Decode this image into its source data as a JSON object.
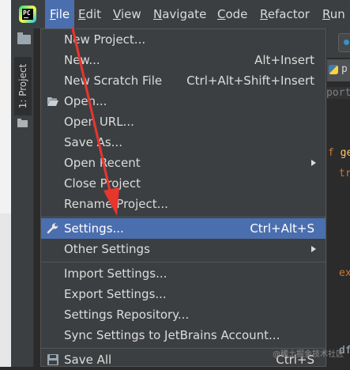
{
  "menubar": {
    "items": [
      {
        "label": "File",
        "mnemonic": "F",
        "rest": "ile",
        "active": true
      },
      {
        "label": "Edit",
        "mnemonic": "E",
        "rest": "dit"
      },
      {
        "label": "View",
        "mnemonic": "V",
        "rest": "iew"
      },
      {
        "label": "Navigate",
        "mnemonic": "N",
        "rest": "avigate"
      },
      {
        "label": "Code",
        "mnemonic": "C",
        "rest": "ode"
      },
      {
        "label": "Refactor",
        "mnemonic": "R",
        "rest": "efactor"
      },
      {
        "label": "Run",
        "mnemonic": "R",
        "rest": "un"
      }
    ]
  },
  "sidebar": {
    "project_tab": "1: Project"
  },
  "editor_fragments": {
    "tab_text": "p",
    "line1": "port",
    "line2_kw": "f",
    "line2_rest": " ge",
    "line3": "tr",
    "line4": "ex",
    "line5": "df"
  },
  "file_menu": {
    "items": [
      {
        "label": "New Project...",
        "shortcut": ""
      },
      {
        "label": "New...",
        "shortcut": "Alt+Insert"
      },
      {
        "label": "New Scratch File",
        "shortcut": "Ctrl+Alt+Shift+Insert"
      },
      {
        "label": "Open...",
        "shortcut": ""
      },
      {
        "label": "Open URL...",
        "shortcut": ""
      },
      {
        "label": "Save As...",
        "shortcut": ""
      },
      {
        "label": "Open Recent",
        "shortcut": ""
      },
      {
        "label": "Close Project",
        "shortcut": ""
      },
      {
        "label": "Rename Project...",
        "shortcut": ""
      },
      {
        "label": "Settings...",
        "shortcut": "Ctrl+Alt+S"
      },
      {
        "label": "Other Settings",
        "shortcut": ""
      },
      {
        "label": "Import Settings...",
        "shortcut": ""
      },
      {
        "label": "Export Settings...",
        "shortcut": ""
      },
      {
        "label": "Settings Repository...",
        "shortcut": ""
      },
      {
        "label": "Sync Settings to JetBrains Account...",
        "shortcut": ""
      },
      {
        "label": "Save All",
        "shortcut": "Ctrl+S"
      }
    ]
  },
  "watermark": "@稀土掘金技术社区",
  "colors": {
    "menubar_bg": "#3c3f41",
    "selection": "#4b6eaf",
    "annotation_arrow": "#e8352e"
  }
}
